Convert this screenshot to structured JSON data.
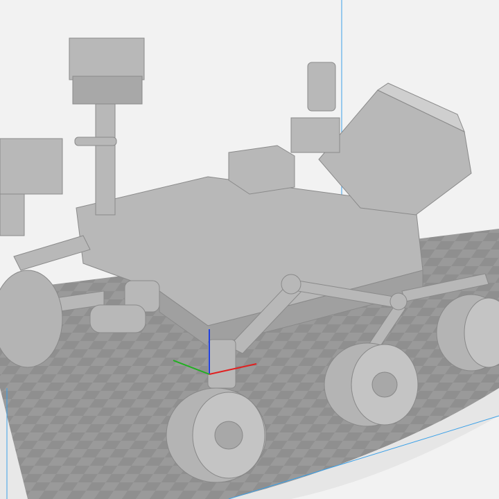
{
  "viewport": {
    "background_color": "#f2f2f2",
    "build_plate_color": "#8f8f8f",
    "build_plate_alt_color": "#9a9a9a",
    "model_color": "#b8b8b8",
    "model_shadow_color": "#8a8a8a",
    "volume_edge_color": "#3aa0e8",
    "icons": [
      "rover-model",
      "axis-gizmo"
    ]
  },
  "axis_gizmo": {
    "x_color": "#e02020",
    "y_color": "#20b020",
    "z_color": "#2040e0"
  }
}
